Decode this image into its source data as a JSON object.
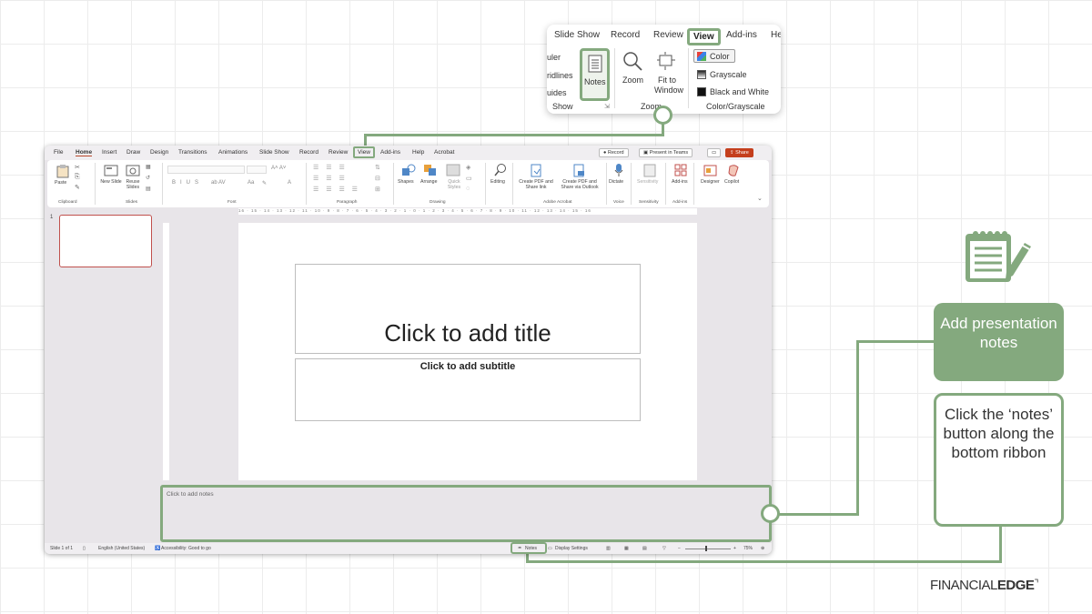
{
  "zoom_popup": {
    "tabs": [
      "Slide Show",
      "Record",
      "Review",
      "View",
      "Add-ins",
      "He"
    ],
    "show_items": [
      "uler",
      "ridlines",
      "uides"
    ],
    "notes_label": "Notes",
    "show_group": "Show",
    "zoom_label": "Zoom",
    "fit_label": "Fit to Window",
    "zoom_group": "Zoom",
    "color_items": [
      "Color",
      "Grayscale",
      "Black and White"
    ],
    "color_group": "Color/Grayscale"
  },
  "ppt": {
    "tabs": [
      "File",
      "Home",
      "Insert",
      "Draw",
      "Design",
      "Transitions",
      "Animations",
      "Slide Show",
      "Record",
      "Review",
      "View",
      "Add-ins",
      "Help",
      "Acrobat"
    ],
    "record_btn": "Record",
    "present_btn": "Present in Teams",
    "share_btn": "Share",
    "ribbon": {
      "paste": "Paste",
      "new_slide": "New Slide",
      "reuse_slides": "Reuse Slides",
      "groups": [
        "Clipboard",
        "Slides",
        "Font",
        "Paragraph",
        "Drawing",
        "Adobe Acrobat",
        "Voice",
        "Sensitivity",
        "Add-ins"
      ],
      "shapes": "Shapes",
      "arrange": "Arrange",
      "quick_styles": "Quick Styles",
      "editing": "Editing",
      "create_pdf_share": "Create PDF and Share link",
      "create_pdf_outlook": "Create PDF and Share via Outlook",
      "dictate": "Dictate",
      "sensitivity": "Sensitivity",
      "addins": "Add-ins",
      "designer": "Designer",
      "copilot": "Copilot"
    },
    "ruler_text": "16 · 15 · 14 · 13 · 12 · 11 · 10 · 9 · 8 · 7 · 6 · 5 · 4 · 3 · 2 · 1 · 0 · 1 · 2 · 3 · 4 · 5 · 6 · 7 · 8 · 9 · 10 · 11 · 12 · 13 · 14 · 15 · 16",
    "slide_number": "1",
    "title_placeholder": "Click to add title",
    "subtitle_placeholder": "Click to add subtitle",
    "notes_placeholder": "Click to add notes",
    "status": {
      "slide": "Slide 1 of 1",
      "language": "English (United States)",
      "accessibility": "Accessibility: Good to go",
      "notes": "Notes",
      "display": "Display Settings",
      "zoom": "75%"
    }
  },
  "callouts": {
    "add_notes": "Add presentation notes",
    "click_notes": "Click the ‘notes’ button along the bottom ribbon"
  },
  "logo": {
    "part1": "FINANCIAL",
    "part2": "EDGE"
  },
  "colors": {
    "accent_green": "#84a97e",
    "share_red": "#c43e1c"
  }
}
